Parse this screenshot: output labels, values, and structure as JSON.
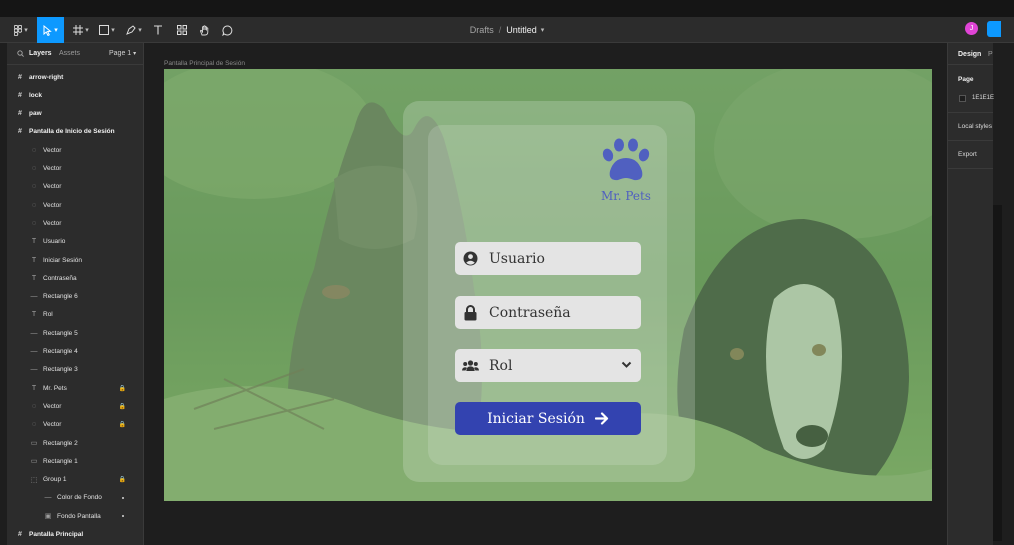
{
  "toolbar": {
    "breadcrumb_project": "Drafts",
    "breadcrumb_separator": "/",
    "file_name": "Untitled",
    "avatar_initial": "J"
  },
  "left_panel": {
    "tab_layers": "Layers",
    "tab_assets": "Assets",
    "page_selector": "Page 1",
    "layers": [
      {
        "label": "arrow-right",
        "icon": "frame-icon",
        "top": true
      },
      {
        "label": "lock",
        "icon": "frame-icon",
        "top": true
      },
      {
        "label": "paw",
        "icon": "frame-icon",
        "top": true
      },
      {
        "label": "Pantalla de Inicio de Sesión",
        "icon": "frame-icon",
        "top": true
      },
      {
        "label": "Vector",
        "icon": "vector-icon"
      },
      {
        "label": "Vector",
        "icon": "vector-icon"
      },
      {
        "label": "Vector",
        "icon": "vector-icon"
      },
      {
        "label": "Vector",
        "icon": "vector-icon"
      },
      {
        "label": "Vector",
        "icon": "vector-icon"
      },
      {
        "label": "Usuario",
        "icon": "text-icon"
      },
      {
        "label": "Iniciar Sesión",
        "icon": "text-icon"
      },
      {
        "label": "Contraseña",
        "icon": "text-icon"
      },
      {
        "label": "Rectangle 6",
        "icon": "line-icon"
      },
      {
        "label": "Rol",
        "icon": "text-icon"
      },
      {
        "label": "Rectangle 5",
        "icon": "line-icon"
      },
      {
        "label": "Rectangle 4",
        "icon": "line-icon"
      },
      {
        "label": "Rectangle 3",
        "icon": "line-icon"
      },
      {
        "label": "Mr. Pets",
        "icon": "text-icon",
        "locked": true
      },
      {
        "label": "Vector",
        "icon": "vector-icon",
        "locked": true
      },
      {
        "label": "Vector",
        "icon": "vector-icon",
        "locked": true
      },
      {
        "label": "Rectangle 2",
        "icon": "rectangle-icon"
      },
      {
        "label": "Rectangle 1",
        "icon": "rectangle-icon"
      },
      {
        "label": "Group 1",
        "icon": "group-icon",
        "locked": true
      },
      {
        "label": "Color de Fondo",
        "icon": "line-icon",
        "dot": true
      },
      {
        "label": "Fondo Pantalla",
        "icon": "image-icon",
        "dot": true
      },
      {
        "label": "Pantalla Principal",
        "icon": "frame-icon",
        "top": true
      }
    ]
  },
  "right_panel": {
    "tab_design": "Design",
    "tab_prototype": "P",
    "page_section": "Page",
    "page_color": "1E1E1E",
    "local_styles": "Local styles",
    "export": "Export"
  },
  "canvas": {
    "frame_label": "Pantalla Principal de Sesión",
    "brand": "Mr. Pets",
    "username_placeholder": "Usuario",
    "password_placeholder": "Contraseña",
    "role_selected": "Rol",
    "submit_label": "Iniciar Sesión"
  },
  "colors": {
    "accent": "#0d99ff",
    "brand_blue": "#3343b0",
    "brand_text": "#5060c0",
    "canvas_bg": "#1e1e1e"
  }
}
